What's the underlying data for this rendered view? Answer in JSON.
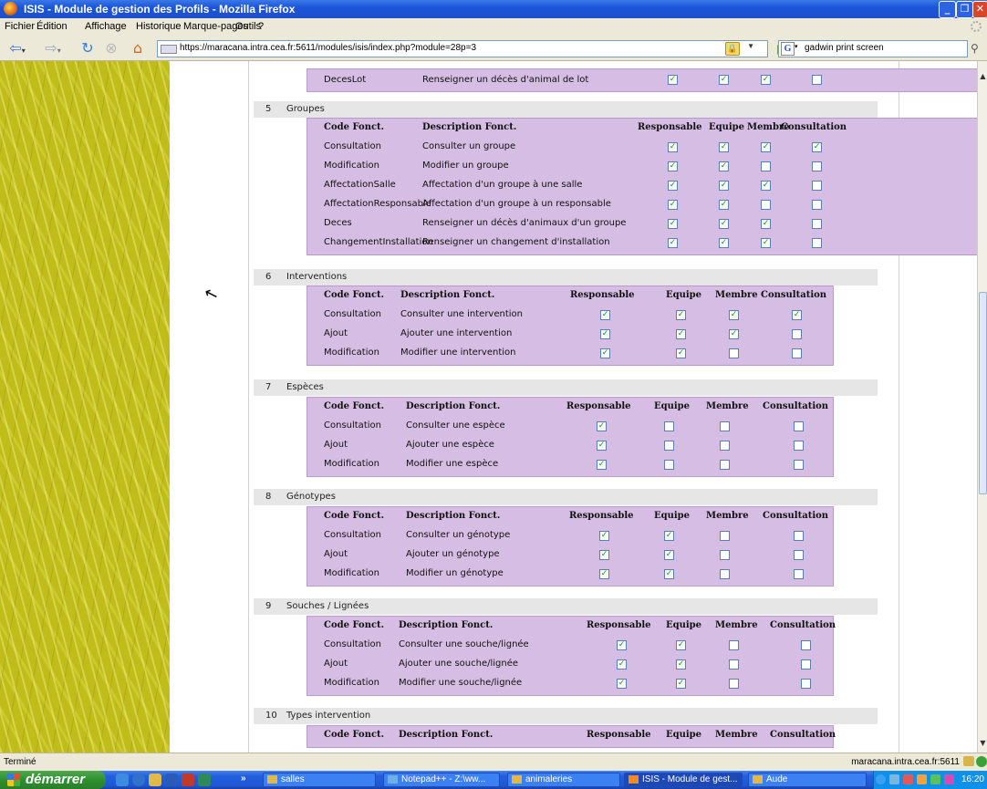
{
  "window": {
    "title": "ISIS - Module de gestion des Profils - Mozilla Firefox"
  },
  "menu": [
    "Fichier",
    "Édition",
    "Affichage",
    "Historique",
    "Marque-pages",
    "Outils",
    "?"
  ],
  "address": {
    "url": "https://maracana.intra.cea.fr:5611/modules/isis/index.php?module=28p=3"
  },
  "search": {
    "value": "gadwin print screen"
  },
  "headers": {
    "code": "Code Fonct.",
    "desc": "Description Fonct.",
    "resp": "Responsable",
    "equipe": "Equipe",
    "membre": "Membre",
    "consult": "Consultation"
  },
  "partial_row": {
    "code": "DecesLot",
    "desc": "Renseigner un décès d'animal de lot",
    "checks": [
      true,
      true,
      true,
      false
    ]
  },
  "sections": [
    {
      "num": "5",
      "name": "Groupes",
      "rows": [
        {
          "code": "Consultation",
          "desc": "Consulter un groupe",
          "checks": [
            true,
            true,
            true,
            true
          ]
        },
        {
          "code": "Modification",
          "desc": "Modifier un groupe",
          "checks": [
            true,
            true,
            false,
            false
          ]
        },
        {
          "code": "AffectationSalle",
          "desc": "Affectation d'un groupe à une salle",
          "checks": [
            true,
            true,
            true,
            false
          ]
        },
        {
          "code": "AffectationResponsable",
          "desc": "Affectation d'un groupe à un responsable",
          "checks": [
            true,
            true,
            false,
            false
          ]
        },
        {
          "code": "Deces",
          "desc": "Renseigner un décès d'animaux d'un groupe",
          "checks": [
            true,
            true,
            true,
            false
          ]
        },
        {
          "code": "ChangementInstallation",
          "desc": "Renseigner un changement d'installation",
          "checks": [
            true,
            true,
            true,
            false
          ]
        }
      ]
    },
    {
      "num": "6",
      "name": "Interventions",
      "rows": [
        {
          "code": "Consultation",
          "desc": "Consulter une intervention",
          "checks": [
            true,
            true,
            true,
            true
          ]
        },
        {
          "code": "Ajout",
          "desc": "Ajouter une intervention",
          "checks": [
            true,
            true,
            true,
            false
          ]
        },
        {
          "code": "Modification",
          "desc": "Modifier une intervention",
          "checks": [
            true,
            true,
            false,
            false
          ]
        }
      ]
    },
    {
      "num": "7",
      "name": "Espèces",
      "rows": [
        {
          "code": "Consultation",
          "desc": "Consulter une espèce",
          "checks": [
            true,
            false,
            false,
            false
          ]
        },
        {
          "code": "Ajout",
          "desc": "Ajouter une espèce",
          "checks": [
            true,
            false,
            false,
            false
          ]
        },
        {
          "code": "Modification",
          "desc": "Modifier une espèce",
          "checks": [
            true,
            false,
            false,
            false
          ]
        }
      ]
    },
    {
      "num": "8",
      "name": "Génotypes",
      "rows": [
        {
          "code": "Consultation",
          "desc": "Consulter un génotype",
          "checks": [
            true,
            true,
            false,
            false
          ]
        },
        {
          "code": "Ajout",
          "desc": "Ajouter un génotype",
          "checks": [
            true,
            true,
            false,
            false
          ]
        },
        {
          "code": "Modification",
          "desc": "Modifier un génotype",
          "checks": [
            true,
            true,
            false,
            false
          ]
        }
      ]
    },
    {
      "num": "9",
      "name": "Souches / Lignées",
      "rows": [
        {
          "code": "Consultation",
          "desc": "Consulter une souche/lignée",
          "checks": [
            true,
            true,
            false,
            false
          ]
        },
        {
          "code": "Ajout",
          "desc": "Ajouter une souche/lignée",
          "checks": [
            true,
            true,
            false,
            false
          ]
        },
        {
          "code": "Modification",
          "desc": "Modifier une souche/lignée",
          "checks": [
            true,
            true,
            false,
            false
          ]
        }
      ]
    },
    {
      "num": "10",
      "name": "Types intervention",
      "rows": []
    }
  ],
  "status": {
    "left": "Terminé",
    "right": "maracana.intra.cea.fr:5611"
  },
  "taskbar": {
    "start": "démarrer",
    "items": [
      {
        "label": "salles",
        "active": false
      },
      {
        "label": "Notepad++ - Z:\\ww...",
        "active": false
      },
      {
        "label": "animaleries",
        "active": false
      },
      {
        "label": "ISIS - Module de gest...",
        "active": true
      },
      {
        "label": "Aude",
        "active": false
      }
    ],
    "clock": "16:20"
  },
  "colors": {
    "panel": "#d6bde3",
    "section_bar": "#e6e6e6",
    "sidebar": "#c0bd1b"
  }
}
